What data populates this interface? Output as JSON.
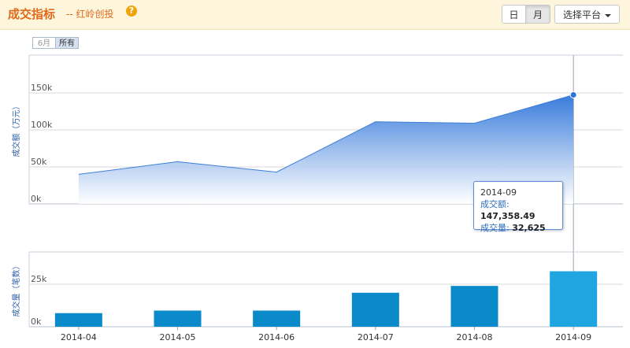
{
  "header": {
    "title": "成交指标",
    "subtitle": "-- 红岭创投",
    "help_icon": "question-circle-icon",
    "buttons": {
      "day": "日",
      "month": "月",
      "platform": "选择平台"
    }
  },
  "range_selector": {
    "six_month": "6月",
    "all": "所有"
  },
  "tooltip": {
    "date": "2014-09",
    "amount_label": "成交额:",
    "amount_value": "147,358.49",
    "volume_label": "成交量:",
    "volume_value": "32,625"
  },
  "colors": {
    "area_top": "#2d74d9",
    "area_bottom": "#ffffff",
    "bar": "#0a8ac9",
    "bar_highlight": "#1fa6e1",
    "accent": "#e06a1b"
  },
  "chart_data": [
    {
      "type": "area",
      "ylabel": "成交额（万元）",
      "ylim": [
        0,
        150000
      ],
      "yticks": [
        "0k",
        "50k",
        "100k",
        "150k"
      ],
      "x": [
        "2014-04",
        "2014-05",
        "2014-06",
        "2014-07",
        "2014-08",
        "2014-09"
      ],
      "values": [
        40000,
        57000,
        43000,
        111000,
        109000,
        147358.49
      ]
    },
    {
      "type": "bar",
      "ylabel": "成交量（笔数）",
      "ylim": [
        0,
        25000
      ],
      "yticks": [
        "0k",
        "25k"
      ],
      "categories": [
        "2014-04",
        "2014-05",
        "2014-06",
        "2014-07",
        "2014-08",
        "2014-09"
      ],
      "values": [
        8000,
        9500,
        9500,
        20000,
        24000,
        32625
      ],
      "highlight_index": 5
    }
  ]
}
